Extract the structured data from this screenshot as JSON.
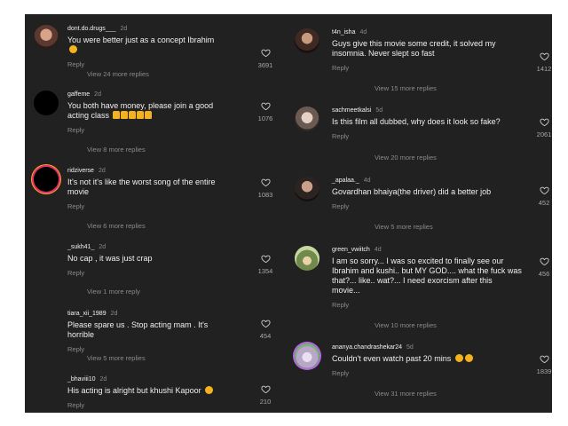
{
  "reply_label": "Reply",
  "left": [
    {
      "user": "dont.do.drugs___",
      "age": "2d",
      "text": "You were better just as a concept Ibrahim",
      "emoji": "😥",
      "likes": "3691",
      "view_more": "View 24 more replies"
    },
    {
      "user": "gaffeme",
      "age": "2d",
      "text": "You both have money, please join a good acting class",
      "emoji": "🙏🙏🙏🙏🙏",
      "likes": "1076",
      "view_more": "View 8 more replies"
    },
    {
      "user": "ridziverse",
      "age": "2d",
      "text": "It's not it's like the worst song of the entire movie",
      "emoji": "",
      "likes": "1083",
      "view_more": "View 6 more replies"
    },
    {
      "user": "_sukh41_",
      "age": "2d",
      "text": "No cap , it was just crap",
      "emoji": "",
      "likes": "1354",
      "view_more": "View 1 more reply"
    },
    {
      "user": "tiara_xii_1989",
      "age": "2d",
      "text": "Please spare us . Stop acting mam . It's horrible",
      "emoji": "",
      "likes": "454",
      "view_more": "View 5 more replies"
    },
    {
      "user": "_bhaviii10",
      "age": "2d",
      "text": "His acting is alright but khushi Kapoor",
      "emoji": "😩",
      "likes": "210",
      "view_more": ""
    }
  ],
  "right": [
    {
      "user": "t4n_isha",
      "age": "4d",
      "text": "Guys give this movie some credit, it solved my insomnia. Never slept so fast",
      "emoji": "",
      "likes": "1412",
      "view_more": "View 15 more replies"
    },
    {
      "user": "sachmeetkalsi",
      "age": "5d",
      "text": "Is this film all dubbed, why does it look so fake?",
      "emoji": "",
      "likes": "2061",
      "view_more": "View 20 more replies"
    },
    {
      "user": "_apalaa._",
      "age": "4d",
      "text": "Govardhan bhaiya(the driver) did a better job",
      "emoji": "",
      "likes": "452",
      "view_more": "View 5 more replies"
    },
    {
      "user": "green_vwiitch",
      "age": "4d",
      "text": "I am so sorry... I was so excited to finally see our Ibrahim and kushi.. but  MY GOD.... what the fuck was that?... like.. wat?... I need exorcism after this movie...",
      "emoji": "",
      "likes": "456",
      "view_more": "View 10 more replies"
    },
    {
      "user": "ananya.chandrashekar24",
      "age": "5d",
      "text": "Couldn't even watch past 20 mins",
      "emoji": "😭😭",
      "likes": "1839",
      "view_more": "View 31 more replies"
    }
  ]
}
